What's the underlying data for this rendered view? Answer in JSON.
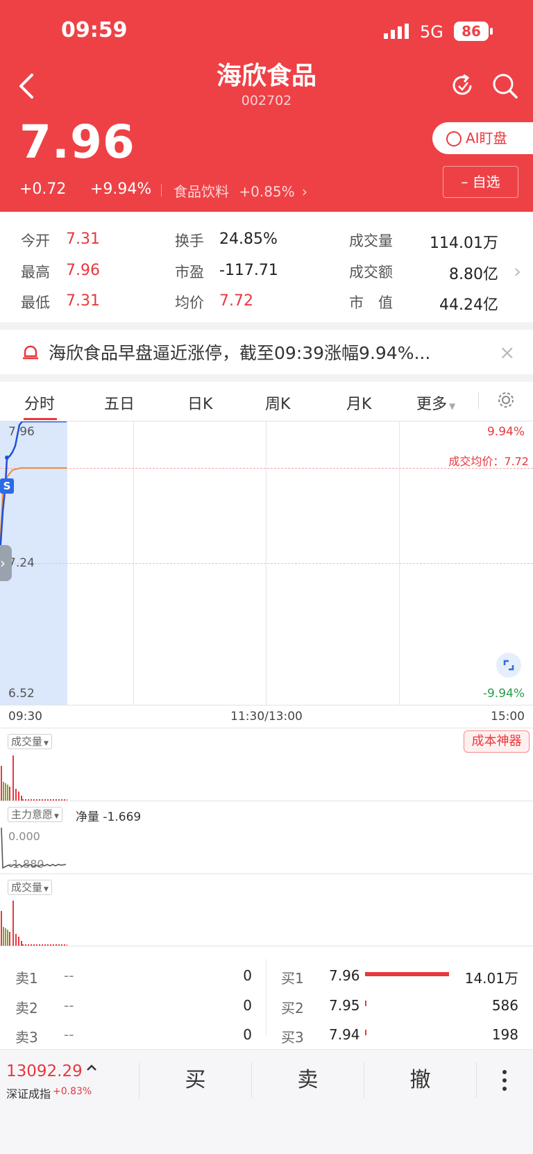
{
  "status_bar": {
    "time": "09:59",
    "network": "5G",
    "battery": "86"
  },
  "stock": {
    "name": "海欣食品",
    "code": "002702",
    "price": "7.96",
    "change": "+0.72",
    "change_pct": "+9.94%",
    "sector": "食品饮料",
    "sector_pct": "+0.85%",
    "ai_button": "AI盯盘",
    "watch_button": "自选"
  },
  "stats": {
    "open_label": "今开",
    "open": "7.31",
    "high_label": "最高",
    "high": "7.96",
    "low_label": "最低",
    "low": "7.31",
    "turnover_label": "换手",
    "turnover": "24.85%",
    "pe_label": "市盈",
    "pe": "-117.71",
    "avg_label": "均价",
    "avg": "7.72",
    "volume_label": "成交量",
    "volume": "114.01万",
    "amount_label": "成交额",
    "amount": "8.80亿",
    "mktcap_label": "市　值",
    "mktcap": "44.24亿"
  },
  "news": {
    "text": "海欣食品早盘逼近涨停，截至09:39涨幅9.94%..."
  },
  "tabs": [
    "分时",
    "五日",
    "日K",
    "周K",
    "月K",
    "更多"
  ],
  "chart": {
    "y_top": "7.96",
    "y_mid": "7.24",
    "y_bottom": "6.52",
    "pct_top": "9.94%",
    "pct_bottom": "-9.94%",
    "avg_label": "成交均价：7.72",
    "time_start": "09:30",
    "time_mid": "11:30/13:00",
    "time_end": "15:00",
    "marker": "S"
  },
  "panels": {
    "volume_select": "成交量",
    "cost_button": "成本神器",
    "main_force_select": "主力意愿",
    "net_label": "净量 -1.669",
    "mf_top": "0.000",
    "mf_bottom": "-1.880",
    "volume_select2": "成交量"
  },
  "orderbook": {
    "sell": [
      {
        "label": "卖1",
        "price": "--",
        "vol": "0"
      },
      {
        "label": "卖2",
        "price": "--",
        "vol": "0"
      },
      {
        "label": "卖3",
        "price": "--",
        "vol": "0"
      }
    ],
    "buy": [
      {
        "label": "买1",
        "price": "7.96",
        "vol": "14.01万",
        "bar": 1.0
      },
      {
        "label": "买2",
        "price": "7.95",
        "vol": "586",
        "bar": 0.004
      },
      {
        "label": "买3",
        "price": "7.94",
        "vol": "198",
        "bar": 0.0015
      }
    ]
  },
  "bottom": {
    "index_value": "13092.29",
    "index_name": "深证成指",
    "index_pct": "+0.83%",
    "buy": "买",
    "sell": "卖",
    "cancel": "撤"
  },
  "colors": {
    "header": "#ee4146",
    "up": "#e8383d",
    "price_line": "#1f4fd6",
    "avg_line": "#f08a3c"
  }
}
